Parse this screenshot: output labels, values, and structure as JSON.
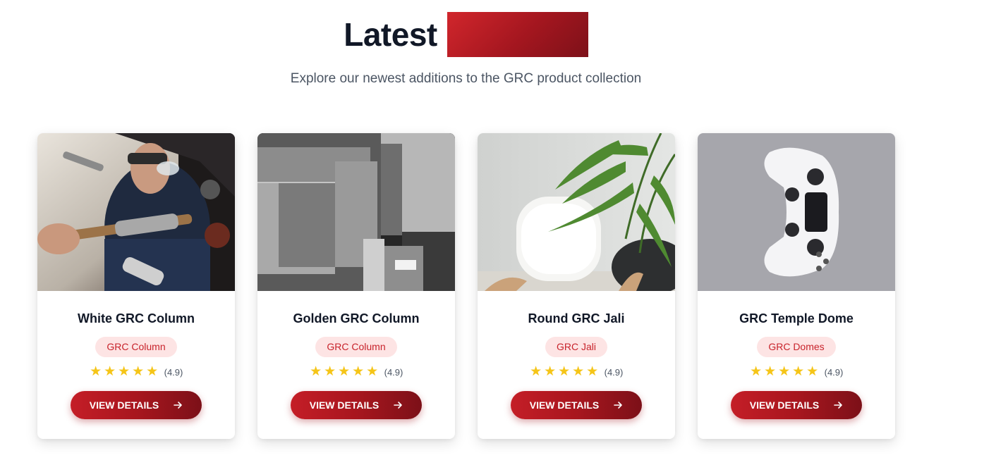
{
  "heading": {
    "word": "Latest",
    "highlight": ""
  },
  "subtitle": "Explore our newest additions to the GRC product collection",
  "colors": {
    "accent": "#b81c24",
    "tag_bg": "#fde4e4",
    "star": "#f5c518"
  },
  "products": [
    {
      "title": "White GRC Column",
      "tag": "GRC Column",
      "stars": 5,
      "rating": "(4.9)",
      "button": "VIEW DETAILS",
      "image": "welder-with-torch-photo"
    },
    {
      "title": "Golden GRC Column",
      "tag": "GRC Column",
      "stars": 5,
      "rating": "(4.9)",
      "button": "VIEW DETAILS",
      "image": "concrete-blocks-photo"
    },
    {
      "title": "Round GRC Jali",
      "tag": "GRC Jali",
      "stars": 5,
      "rating": "(4.9)",
      "button": "VIEW DETAILS",
      "image": "white-chair-with-palm-photo"
    },
    {
      "title": "GRC Temple Dome",
      "tag": "GRC Domes",
      "stars": 5,
      "rating": "(4.9)",
      "button": "VIEW DETAILS",
      "image": "white-game-controller-photo"
    }
  ]
}
